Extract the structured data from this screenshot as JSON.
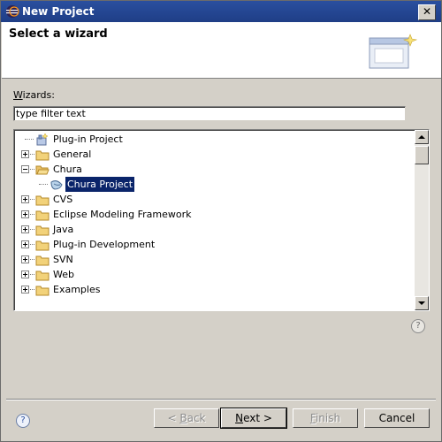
{
  "window": {
    "title": "New Project",
    "close_label": "✕"
  },
  "header": {
    "title": "Select a wizard",
    "graphic_icon": "new-wizard-banner-icon"
  },
  "wizards": {
    "label_access": "W",
    "label_rest": "izards:",
    "filter_value": "type filter text",
    "items": [
      {
        "label": "Plug-in Project",
        "icon": "plugin-project-icon",
        "expander": "none",
        "selected": false
      },
      {
        "label": "General",
        "icon": "folder-icon",
        "expander": "plus",
        "selected": false
      },
      {
        "label": "Chura",
        "icon": "open-folder-icon",
        "expander": "minus",
        "selected": false
      },
      {
        "label": "Chura Project",
        "icon": "chura-project-icon",
        "expander": "none",
        "selected": true
      },
      {
        "label": "CVS",
        "icon": "folder-icon",
        "expander": "plus",
        "selected": false
      },
      {
        "label": "Eclipse Modeling Framework",
        "icon": "folder-icon",
        "expander": "plus",
        "selected": false
      },
      {
        "label": "Java",
        "icon": "folder-icon",
        "expander": "plus",
        "selected": false
      },
      {
        "label": "Plug-in Development",
        "icon": "folder-icon",
        "expander": "plus",
        "selected": false
      },
      {
        "label": "SVN",
        "icon": "folder-icon",
        "expander": "plus",
        "selected": false
      },
      {
        "label": "Web",
        "icon": "folder-icon",
        "expander": "plus",
        "selected": false
      },
      {
        "label": "Examples",
        "icon": "folder-icon",
        "expander": "plus",
        "selected": false
      }
    ]
  },
  "buttons": {
    "back_access": "B",
    "back_rest": "ack",
    "back_prefix": "< ",
    "next_access": "N",
    "next_rest": "ext >",
    "finish_access": "F",
    "finish_rest": "inish",
    "cancel": "Cancel"
  },
  "help_symbol": "?"
}
